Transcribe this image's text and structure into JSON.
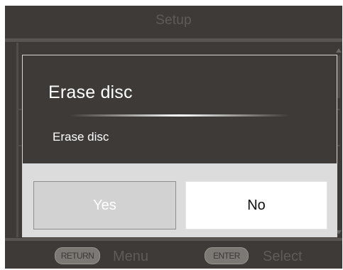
{
  "header": {
    "title": "Setup"
  },
  "dialog": {
    "title": "Erase disc",
    "message": "Erase disc",
    "buttons": {
      "yes": "Yes",
      "no": "No"
    },
    "focused_button": "no"
  },
  "footer": {
    "return_key": "RETURN",
    "return_label": "Menu",
    "enter_key": "ENTER",
    "enter_label": "Select"
  },
  "colors": {
    "background": "#3d3a37",
    "dialog_button_area": "#dcdcdc",
    "focused_button": "#ffffff",
    "unfocused_button": "#d2d2d2",
    "dim_text": "#5e5b58"
  }
}
